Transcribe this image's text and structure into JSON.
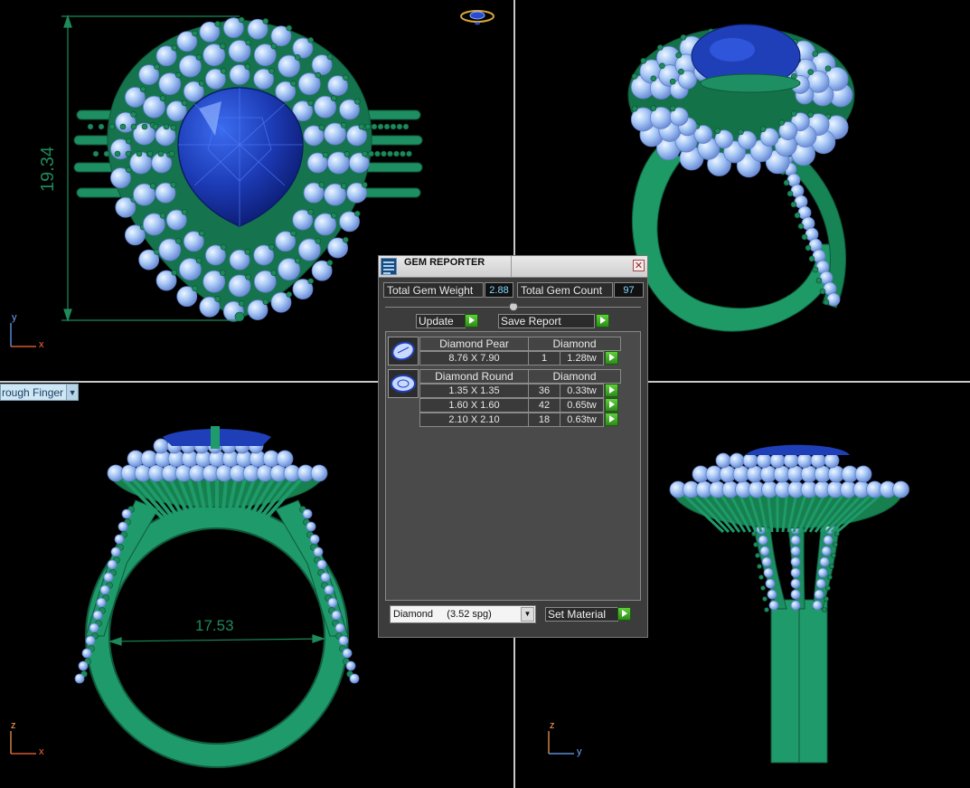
{
  "viewports": {
    "top": {
      "dimension": "19.34",
      "axis_v": "y",
      "axis_h": "x"
    },
    "front": {
      "dimension": "17.53",
      "axis_v": "z",
      "axis_h": "x"
    },
    "side": {
      "axis_v": "z",
      "axis_h": "y"
    }
  },
  "view_dropdown": {
    "label": "rough Finger"
  },
  "gem_reporter": {
    "title": "GEM REPORTER",
    "close_glyph": "✕",
    "total_weight_label": "Total Gem Weight",
    "total_weight_value": "2.88",
    "total_count_label": "Total Gem Count",
    "total_count_value": "97",
    "update_label": "Update",
    "save_report_label": "Save Report",
    "groups": [
      {
        "shape": "Diamond Pear",
        "material": "Diamond",
        "rows": [
          {
            "size": "8.76 X 7.90",
            "count": "1",
            "weight": "1.28tw"
          }
        ]
      },
      {
        "shape": "Diamond Round",
        "material": "Diamond",
        "rows": [
          {
            "size": "1.35 X 1.35",
            "count": "36",
            "weight": "0.33tw"
          },
          {
            "size": "1.60 X 1.60",
            "count": "42",
            "weight": "0.65tw"
          },
          {
            "size": "2.10 X 2.10",
            "count": "18",
            "weight": "0.63tw"
          }
        ]
      }
    ],
    "material_select": "Diamond     (3.52 spg)",
    "set_material_label": "Set Material"
  },
  "colors": {
    "metal": "#1f9a6a",
    "metal_dark": "#0f5a3c",
    "diamond": "#a8c8f4",
    "sapphire": "#1f3fb8",
    "dimension": "#1e8a5a"
  }
}
